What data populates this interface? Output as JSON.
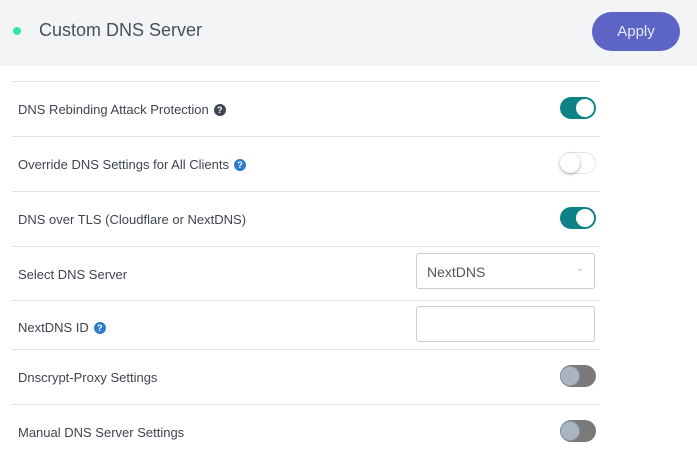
{
  "header": {
    "title": "Custom DNS Server",
    "apply_label": "Apply",
    "status_color": "#2ee8a6"
  },
  "rows": [
    {
      "label": "DNS Rebinding Attack Protection",
      "help": "?",
      "toggle": "on"
    },
    {
      "label": "Override DNS Settings for All Clients",
      "help": "?",
      "toggle": "off"
    },
    {
      "label": "DNS over TLS (Cloudflare or NextDNS)",
      "toggle": "on"
    },
    {
      "label": "Select DNS Server",
      "select_value": "NextDNS"
    },
    {
      "label": "NextDNS ID",
      "help": "?",
      "input_value": ""
    },
    {
      "label": "Dnscrypt-Proxy Settings",
      "toggle": "disabled"
    },
    {
      "label": "Manual DNS Server Settings",
      "toggle": "disabled"
    }
  ]
}
